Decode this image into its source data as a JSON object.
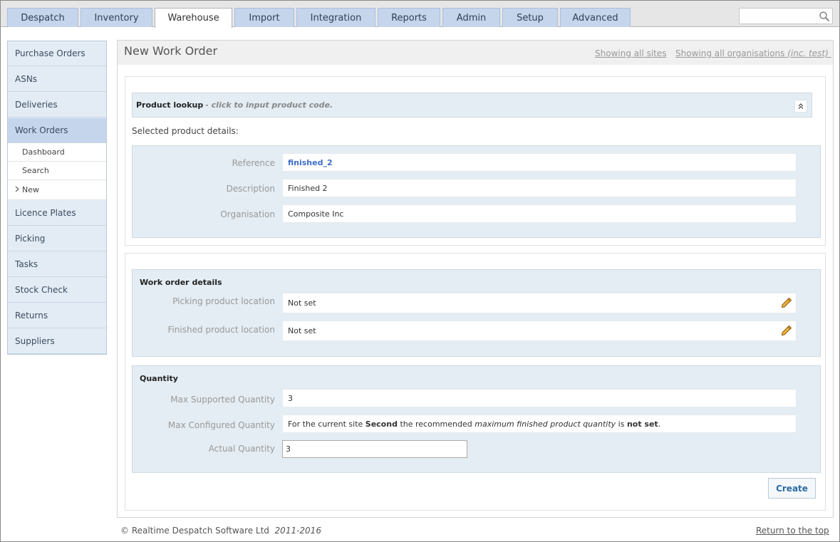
{
  "nav": {
    "tabs": [
      {
        "label": "Despatch"
      },
      {
        "label": "Inventory"
      },
      {
        "label": "Warehouse"
      },
      {
        "label": "Import"
      },
      {
        "label": "Integration"
      },
      {
        "label": "Reports"
      },
      {
        "label": "Admin"
      },
      {
        "label": "Setup"
      },
      {
        "label": "Advanced"
      }
    ],
    "active_tab": "Warehouse",
    "search": {
      "value": "",
      "placeholder": ""
    }
  },
  "sidebar": {
    "items": [
      {
        "label": "Purchase Orders"
      },
      {
        "label": "ASNs"
      },
      {
        "label": "Deliveries"
      },
      {
        "label": "Work Orders"
      },
      {
        "label": "Licence Plates"
      },
      {
        "label": "Picking"
      },
      {
        "label": "Tasks"
      },
      {
        "label": "Stock Check"
      },
      {
        "label": "Returns"
      },
      {
        "label": "Suppliers"
      }
    ],
    "active_item": "Work Orders",
    "sub_items": [
      {
        "label": "Dashboard"
      },
      {
        "label": "Search"
      },
      {
        "label": "New"
      }
    ],
    "active_sub_item": "New"
  },
  "header": {
    "title": "New Work Order",
    "sites_link": "Showing all sites",
    "orgs_link": "Showing all organisations",
    "orgs_link_suffix": "(inc. test)"
  },
  "lookup": {
    "label": "Product lookup",
    "hint": "- click to input product code."
  },
  "selected_heading": "Selected product details:",
  "product": {
    "reference_label": "Reference",
    "reference_value": "finished_2",
    "description_label": "Description",
    "description_value": "Finished 2",
    "organisation_label": "Organisation",
    "organisation_value": "Composite Inc"
  },
  "work_order": {
    "title": "Work order details",
    "picking_label": "Picking product location",
    "picking_value": "Not set",
    "finished_label": "Finished product location",
    "finished_value": "Not set"
  },
  "quantity": {
    "title": "Quantity",
    "max_supported_label": "Max Supported Quantity",
    "max_supported_value": "3",
    "max_configured_label": "Max Configured Quantity",
    "max_configured_text": {
      "prefix": "For the current site",
      "site": "Second",
      "middle": "the recommended",
      "emph": "maximum finished product quantity",
      "is": "is",
      "status": "not set",
      "end": "."
    },
    "actual_label": "Actual Quantity",
    "actual_value": "3"
  },
  "create_label": "Create",
  "footer": {
    "copyright": "© Realtime Despatch Software Ltd",
    "years": "2011-2016",
    "top_link": "Return to the top"
  },
  "colors": {
    "tab_bg": "#c5d6ec",
    "sidebar_bg": "#e3ecf5",
    "panel_bg": "#e4edf3",
    "link_blue": "#3d6ec8",
    "button_text": "#2b6ba3"
  }
}
